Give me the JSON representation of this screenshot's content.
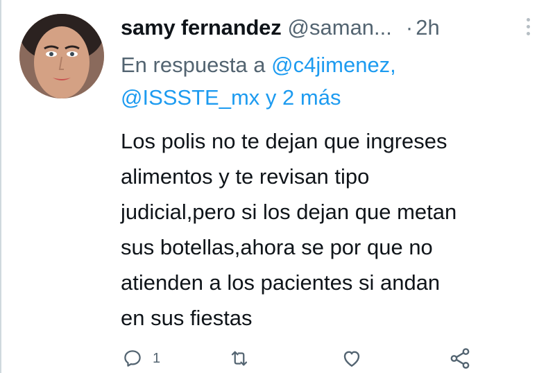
{
  "tweet": {
    "display_name": "samy fernandez",
    "handle": "@saman...",
    "separator": "·",
    "time": "2h",
    "reply": {
      "prefix": "En respuesta a",
      "mention_1": "@c4jimenez,",
      "mention_2": "@ISSSTE_mx",
      "connector": "y",
      "more": "2 más"
    },
    "text_lines": [
      "Los polis no te dejan que ingreses",
      "alimentos y te revisan tipo",
      "judicial,pero si los dejan que metan",
      "sus botellas,ahora se por que no",
      "atienden a los pacientes si andan",
      "en sus fiestas"
    ]
  },
  "actions": {
    "reply_count": "1",
    "reply_icon": "comment-icon",
    "retweet_icon": "retweet-icon",
    "like_icon": "heart-icon",
    "share_icon": "share-icon"
  },
  "colors": {
    "text": "#0f1419",
    "secondary": "#536471",
    "link": "#1d9bf0",
    "border": "#cfd9de"
  }
}
